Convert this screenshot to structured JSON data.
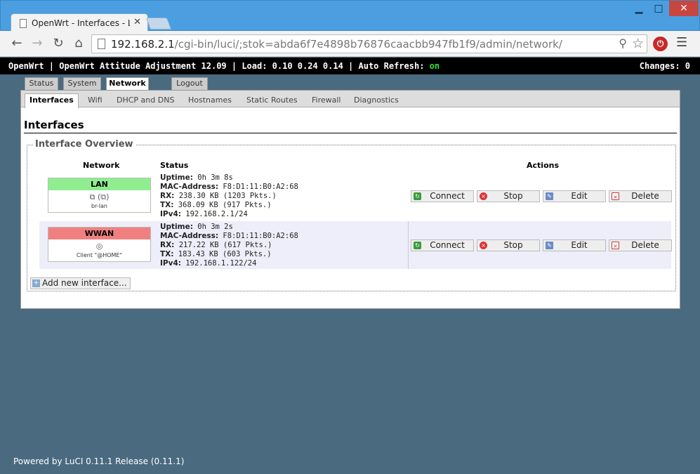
{
  "browser": {
    "tab_title": "OpenWrt - Interfaces - LuCI",
    "url_host": "192.168.2.1",
    "url_path": "/cgi-bin/luci/;stok=abda6f7e4898b76876caacbb947fb1f9/admin/network/"
  },
  "header": {
    "left_text": "OpenWrt | OpenWrt Attitude Adjustment 12.09 | Load: 0.10 0.24 0.14 | Auto Refresh:",
    "auto_refresh": "on",
    "changes": "Changes: 0"
  },
  "main_menu": {
    "status": "Status",
    "system": "System",
    "network": "Network",
    "logout": "Logout"
  },
  "sub_menu": {
    "interfaces": "Interfaces",
    "wifi": "Wifi",
    "dhcp": "DHCP and DNS",
    "hostnames": "Hostnames",
    "routes": "Static Routes",
    "firewall": "Firewall",
    "diagnostics": "Diagnostics"
  },
  "page": {
    "title": "Interfaces",
    "legend": "Interface Overview",
    "col_network": "Network",
    "col_status": "Status",
    "col_actions": "Actions"
  },
  "labels": {
    "uptime": "Uptime:",
    "mac": "MAC-Address:",
    "rx": "RX:",
    "tx": "TX:",
    "ipv4": "IPv4:"
  },
  "interfaces": [
    {
      "name": "LAN",
      "color": "#90ee90",
      "icons": "(  )",
      "device": "br-lan",
      "uptime": "0h 3m 8s",
      "mac": "F8:D1:11:B0:A2:68",
      "rx": "238.30 KB (1203 Pkts.)",
      "tx": "368.09 KB (917 Pkts.)",
      "ipv4": "192.168.2.1/24"
    },
    {
      "name": "WWAN",
      "color": "#f08080",
      "device": "Client \"@HOME\"",
      "uptime": "0h 3m 2s",
      "mac": "F8:D1:11:B0:A2:68",
      "rx": "217.22 KB (617 Pkts.)",
      "tx": "183.43 KB (603 Pkts.)",
      "ipv4": "192.168.1.122/24"
    }
  ],
  "buttons": {
    "connect": "Connect",
    "stop": "Stop",
    "edit": "Edit",
    "delete": "Delete",
    "add": "Add new interface..."
  },
  "footer": "Powered by LuCI 0.11.1 Release (0.11.1)"
}
